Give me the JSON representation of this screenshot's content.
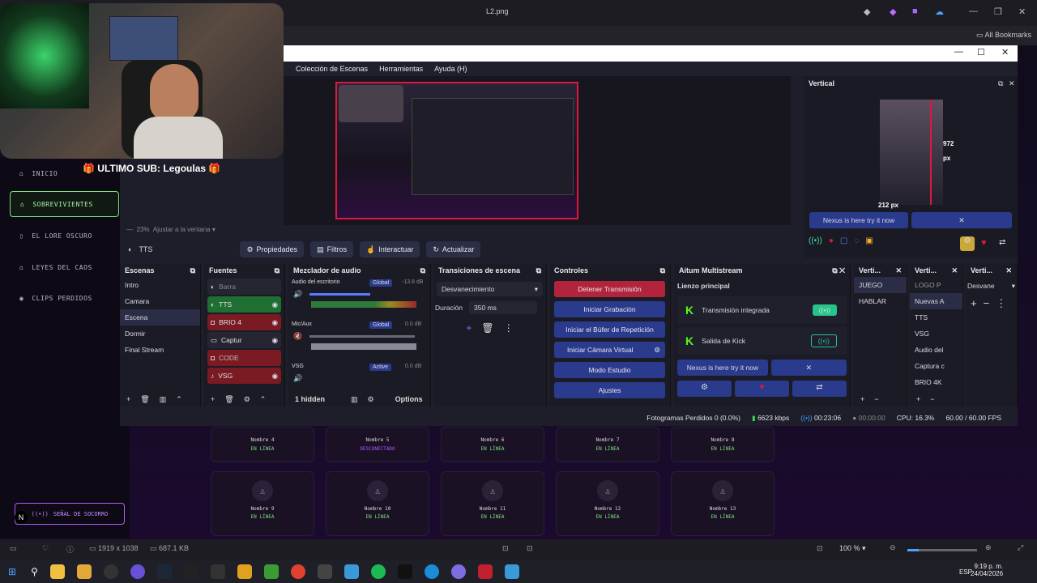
{
  "viewer": {
    "title": "L2.png",
    "bookmarks": "All Bookmarks",
    "dimensions": "1919 x 1038",
    "filesize": "687.1 KB",
    "zoom": "100 %"
  },
  "site": {
    "sub_banner": "🎁 ULTIMO SUB: Legoulas 🎁",
    "nav": [
      "INICIO",
      "SOBREVIVIENTES",
      "EL LORE OSCURO",
      "LEYES DEL CAOS",
      "CLIPS PERDIDOS"
    ],
    "signal_button": "SEÑAL DE SOCORRO",
    "cards_row1": [
      {
        "name": "Nombre 4",
        "status": "EN LÍNEA"
      },
      {
        "name": "Nombre 5",
        "status": "DESCONECTADO"
      },
      {
        "name": "Nombre 6",
        "status": "EN LÍNEA"
      },
      {
        "name": "Nombre 7",
        "status": "EN LÍNEA"
      },
      {
        "name": "Nombre 8",
        "status": "EN LÍNEA"
      }
    ],
    "cards_row2": [
      {
        "name": "Nombre 9",
        "status": "EN LÍNEA"
      },
      {
        "name": "Nombre 10",
        "status": "EN LÍNEA"
      },
      {
        "name": "Nombre 11",
        "status": "EN LÍNEA"
      },
      {
        "name": "Nombre 12",
        "status": "EN LÍNEA"
      },
      {
        "name": "Nombre 13",
        "status": "EN LÍNEA"
      }
    ]
  },
  "obs": {
    "menu": [
      "Colección de Escenas",
      "Herramientas",
      "Ayuda (H)"
    ],
    "zoom_text": "23%",
    "fit_text": "Ajustar a la ventana",
    "vertical_title": "Vertical",
    "vertical_w": "972 px",
    "vertical_h": "212 px",
    "vertical_nexus": "Nexus is here try it now",
    "toolbar_source": "TTS",
    "toolbar_buttons": [
      "Propiedades",
      "Filtros",
      "Interactuar",
      "Actualizar"
    ],
    "scenes_title": "Escenas",
    "scenes": [
      "Intro",
      "Camara",
      "Escena",
      "Dormir",
      "Final Stream"
    ],
    "sources_title": "Fuentes",
    "sources": [
      "Barra",
      "TTS",
      "BRIO 4",
      "Captur",
      "CODE",
      "VSG"
    ],
    "mixer_title": "Mezclador de audio",
    "mixer": [
      {
        "name": "Audio del escritorio",
        "mode": "Global",
        "db": "-13.8 dB"
      },
      {
        "name": "Mic/Aux",
        "mode": "Global",
        "db": "0.0 dB"
      },
      {
        "name": "VSG",
        "mode": "Active",
        "db": "0.0 dB"
      }
    ],
    "mixer_hidden": "1 hidden",
    "mixer_options": "Options",
    "transitions_title": "Transiciones de escena",
    "transition": "Desvanecimiento",
    "duration_label": "Duración",
    "duration_value": "350 ms",
    "controls_title": "Controles",
    "controls": [
      "Detener Transmisión",
      "Iniciar Grabación",
      "Iniciar el Búfer de Repetición",
      "Iniciar Cámara Virtual",
      "Modo Estudio",
      "Ajustes"
    ],
    "aitum_title": "Aitum Multistream",
    "aitum_main": "Lienzo principal",
    "aitum_outputs": [
      "Transmisión integrada",
      "Salida de Kick"
    ],
    "aitum_nexus": "Nexus is here try it now",
    "vert_scenes_title": "Verti...",
    "vert_scenes": [
      "JUEGO",
      "HABLAR"
    ],
    "vert_sources_title": "Verti...",
    "vert_sources": [
      "LOGO P",
      "Nuevas A",
      "TTS",
      "VSG",
      "Audio del",
      "Captura c",
      "BRIO 4K"
    ],
    "vert_trans_title": "Verti...",
    "vert_trans": "Desvane",
    "status": {
      "dropped": "Fotogramas Perdidos 0 (0.0%)",
      "kbps": "6623 kbps",
      "stream_time": "00:23:06",
      "rec_time": "00:00:00",
      "cpu": "CPU: 16.3%",
      "fps": "60.00 / 60.00 FPS"
    }
  },
  "clock": {
    "time": "9:19 p. m.",
    "date": "24/04/2026",
    "lang": "ESP"
  },
  "colors": {
    "accent_green": "#7de07d",
    "accent_purple": "#b057ff",
    "obs_red": "#e0163c",
    "obs_blue": "#2a3a8c"
  }
}
